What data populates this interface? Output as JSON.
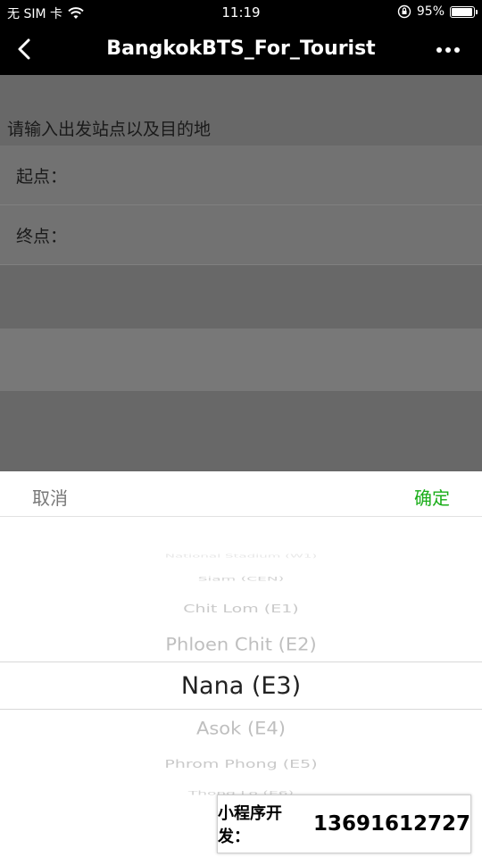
{
  "status_bar": {
    "carrier": "无 SIM 卡",
    "time": "11:19",
    "battery_text": "95%",
    "battery_level": 0.95,
    "icons": [
      "wifi-icon",
      "orientation-lock-icon",
      "battery-icon"
    ]
  },
  "nav": {
    "title": "BangkokBTS_For_Tourist",
    "icons": [
      "back-chevron-icon",
      "more-dots-icon"
    ]
  },
  "form": {
    "prompt": "请输入出发站点以及目的地",
    "start_label": "起点：",
    "end_label": "终点："
  },
  "picker": {
    "cancel_label": "取消",
    "confirm_label": "确定",
    "confirm_color": "#1aad19",
    "options": [
      "National Stadium (W1)",
      "Siam (CEN)",
      "Chit Lom (E1)",
      "Phloen Chit (E2)",
      "Nana (E3)",
      "Asok (E4)",
      "Phrom Phong (E5)",
      "Thong Lo (E6)"
    ],
    "selected": "Nana (E3)"
  },
  "ad": {
    "label": "小程序开发：",
    "phone": "13691612727"
  }
}
